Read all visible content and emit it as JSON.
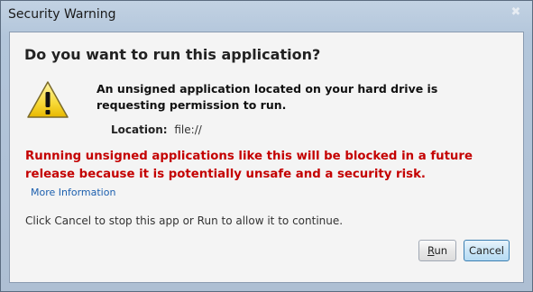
{
  "window": {
    "title": "Security Warning",
    "close_glyph": "✖"
  },
  "dialog": {
    "heading": "Do you want to run this application?",
    "icon": "warning-icon",
    "message": "An unsigned application located on your hard drive is requesting permission to run.",
    "location_label": "Location:",
    "location_value": "file://",
    "warning_text": "Running unsigned applications like this will be blocked in a future release because it is potentially unsafe and a security risk.",
    "more_info_link": "More Information",
    "instructions": "Click Cancel to stop this app or Run to allow it to continue."
  },
  "buttons": {
    "run_mnemonic": "R",
    "run_rest": "un",
    "cancel_label": "Cancel"
  },
  "colors": {
    "warning_text": "#c40000",
    "link": "#1c5fae",
    "default_button_border": "#3c7fb1"
  }
}
